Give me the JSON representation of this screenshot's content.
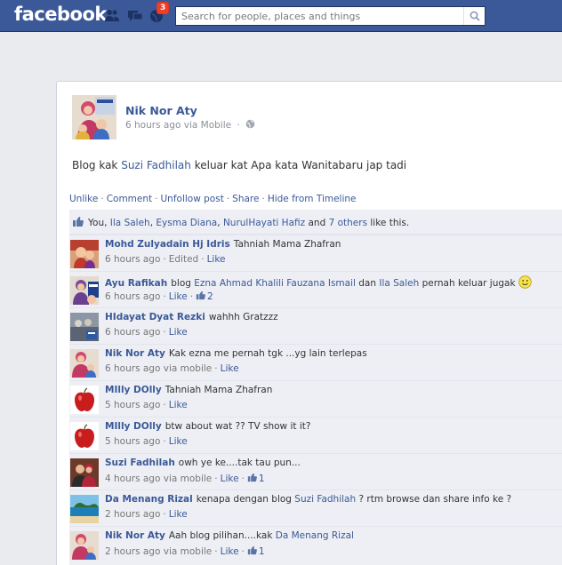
{
  "topbar": {
    "logo": "facebook",
    "notif_count": "3",
    "search": {
      "placeholder": "Search for people, places and things"
    }
  },
  "post": {
    "author": "Nik Nor Aty",
    "meta": "6 hours ago via Mobile",
    "text_parts": [
      "Blog kak ",
      "Suzi Fadhilah",
      " keluar kat Apa kata Wanitabaru jap tadi"
    ],
    "actions": [
      "Unlike",
      "Comment",
      "Unfollow post",
      "Share",
      "Hide from Timeline"
    ]
  },
  "likes": {
    "you": "You, ",
    "names": [
      "Ila Saleh",
      "Eysma Diana",
      "NurulHayati Hafiz"
    ],
    "and": " and ",
    "others": "7 others",
    "suffix": " like this."
  },
  "comments": [
    {
      "name": "Mohd Zulyadain Hj Idris",
      "text": "Tahniah Mama Zhafran",
      "time": "6 hours ago",
      "edited": "Edited",
      "like": "Like",
      "avatar": "man-avatar"
    },
    {
      "name": "Ayu Rafikah",
      "text_a": "blog ",
      "link_a": "Ezna Ahmad Khalili Fauzana Ismail",
      "text_b": " dan ",
      "link_b": "Ila Saleh",
      "text_c": " pernah keluar jugak",
      "time": "6 hours ago",
      "like": "Like",
      "likes_count": "2",
      "avatar": "woman-avatar"
    },
    {
      "name": "HIdayat Dyat Rezki",
      "text": "wahhh Gratzzz",
      "time": "6 hours ago",
      "like": "Like",
      "avatar": "group-avatar"
    },
    {
      "name": "Nik Nor Aty",
      "text": "Kak ezna me pernah tgk ...yg lain terlepas",
      "time": "6 hours ago via mobile",
      "like": "Like",
      "avatar": "family-avatar"
    },
    {
      "name": "MIlly DOlly",
      "text": "Tahniah Mama Zhafran",
      "time": "5 hours ago",
      "like": "Like",
      "avatar": "apple-avatar"
    },
    {
      "name": "MIlly DOlly",
      "text": "btw about wat ?? TV show it it?",
      "time": "5 hours ago",
      "like": "Like",
      "avatar": "apple-avatar"
    },
    {
      "name": "Suzi Fadhilah",
      "text": "owh ye ke....tak tau pun...",
      "time": "4 hours ago via mobile",
      "like": "Like",
      "likes_count": "1",
      "avatar": "couple-avatar"
    },
    {
      "name": "Da Menang Rizal",
      "text_a": "kenapa dengan blog ",
      "link_a": "Suzi Fadhilah",
      "text_b": " ? rtm browse dan share info ke ?",
      "time": "2 hours ago",
      "like": "Like",
      "avatar": "beach-avatar"
    },
    {
      "name": "Nik Nor Aty",
      "text_a": "Aah blog pilihan....kak ",
      "link_a": "Da Menang Rizal",
      "time": "2 hours ago via mobile",
      "like": "Like",
      "likes_count": "1",
      "avatar": "family-avatar"
    }
  ]
}
